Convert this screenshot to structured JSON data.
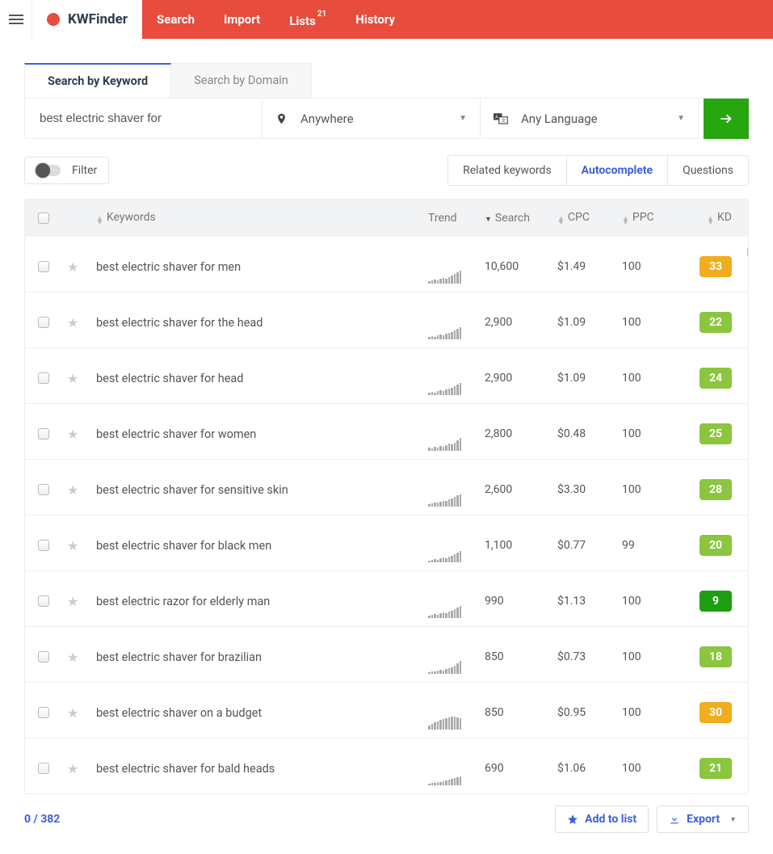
{
  "app": {
    "name": "KWFinder"
  },
  "nav": {
    "items": [
      {
        "label": "Search"
      },
      {
        "label": "Import"
      },
      {
        "label": "Lists",
        "badge": "21"
      },
      {
        "label": "History"
      }
    ]
  },
  "tabs": {
    "by_keyword": "Search by Keyword",
    "by_domain": "Search by Domain"
  },
  "search": {
    "value": "best electric shaver for",
    "location_label": "Anywhere",
    "language_label": "Any Language"
  },
  "filter": {
    "label": "Filter"
  },
  "pills": {
    "related": "Related keywords",
    "autocomplete": "Autocomplete",
    "questions": "Questions"
  },
  "columns": {
    "keywords": "Keywords",
    "trend": "Trend",
    "search": "Search",
    "cpc": "CPC",
    "ppc": "PPC",
    "kd": "KD"
  },
  "kd_colors": {
    "green_dark": "#1e9e11",
    "green_light": "#8bc63e",
    "orange": "#f0ad1f"
  },
  "rows": [
    {
      "keyword": "best electric shaver for men",
      "search": "10,600",
      "cpc": "$1.49",
      "ppc": "100",
      "kd": "33",
      "kd_color": "orange",
      "trend": [
        3,
        4,
        5,
        4,
        6,
        7,
        6,
        8,
        10,
        12,
        14,
        16
      ]
    },
    {
      "keyword": "best electric shaver for the head",
      "search": "2,900",
      "cpc": "$1.09",
      "ppc": "100",
      "kd": "22",
      "kd_color": "green_light",
      "trend": [
        3,
        4,
        3,
        5,
        6,
        5,
        7,
        8,
        9,
        11,
        13,
        15
      ]
    },
    {
      "keyword": "best electric shaver for head",
      "search": "2,900",
      "cpc": "$1.09",
      "ppc": "100",
      "kd": "24",
      "kd_color": "green_light",
      "trend": [
        3,
        4,
        3,
        5,
        6,
        5,
        7,
        8,
        9,
        11,
        13,
        15
      ]
    },
    {
      "keyword": "best electric shaver for women",
      "search": "2,800",
      "cpc": "$0.48",
      "ppc": "100",
      "kd": "25",
      "kd_color": "green_light",
      "trend": [
        4,
        3,
        5,
        4,
        6,
        5,
        7,
        9,
        8,
        10,
        13,
        16
      ]
    },
    {
      "keyword": "best electric shaver for sensitive skin",
      "search": "2,600",
      "cpc": "$3.30",
      "ppc": "100",
      "kd": "28",
      "kd_color": "green_light",
      "trend": [
        3,
        4,
        5,
        5,
        6,
        7,
        7,
        9,
        10,
        12,
        14,
        15
      ]
    },
    {
      "keyword": "best electric shaver for black men",
      "search": "1,100",
      "cpc": "$0.77",
      "ppc": "99",
      "kd": "20",
      "kd_color": "green_light",
      "trend": [
        2,
        3,
        4,
        3,
        5,
        6,
        5,
        7,
        8,
        10,
        12,
        14
      ]
    },
    {
      "keyword": "best electric razor for elderly man",
      "search": "990",
      "cpc": "$1.13",
      "ppc": "100",
      "kd": "9",
      "kd_color": "green_dark",
      "trend": [
        3,
        4,
        5,
        4,
        6,
        7,
        6,
        8,
        9,
        11,
        13,
        15
      ]
    },
    {
      "keyword": "best electric shaver for brazilian",
      "search": "850",
      "cpc": "$0.73",
      "ppc": "100",
      "kd": "18",
      "kd_color": "green_light",
      "trend": [
        2,
        3,
        3,
        4,
        5,
        4,
        6,
        7,
        8,
        10,
        13,
        16
      ]
    },
    {
      "keyword": "best electric shaver on a budget",
      "search": "850",
      "cpc": "$0.95",
      "ppc": "100",
      "kd": "30",
      "kd_color": "orange",
      "trend": [
        5,
        7,
        9,
        10,
        12,
        13,
        14,
        15,
        16,
        16,
        15,
        14
      ]
    },
    {
      "keyword": "best electric shaver for bald heads",
      "search": "690",
      "cpc": "$1.06",
      "ppc": "100",
      "kd": "21",
      "kd_color": "green_light",
      "trend": [
        2,
        3,
        3,
        4,
        4,
        5,
        6,
        7,
        8,
        9,
        10,
        11
      ]
    }
  ],
  "footer": {
    "selected": "0",
    "total": "382",
    "sep": " / ",
    "add_to_list": "Add to list",
    "export": "Export"
  }
}
